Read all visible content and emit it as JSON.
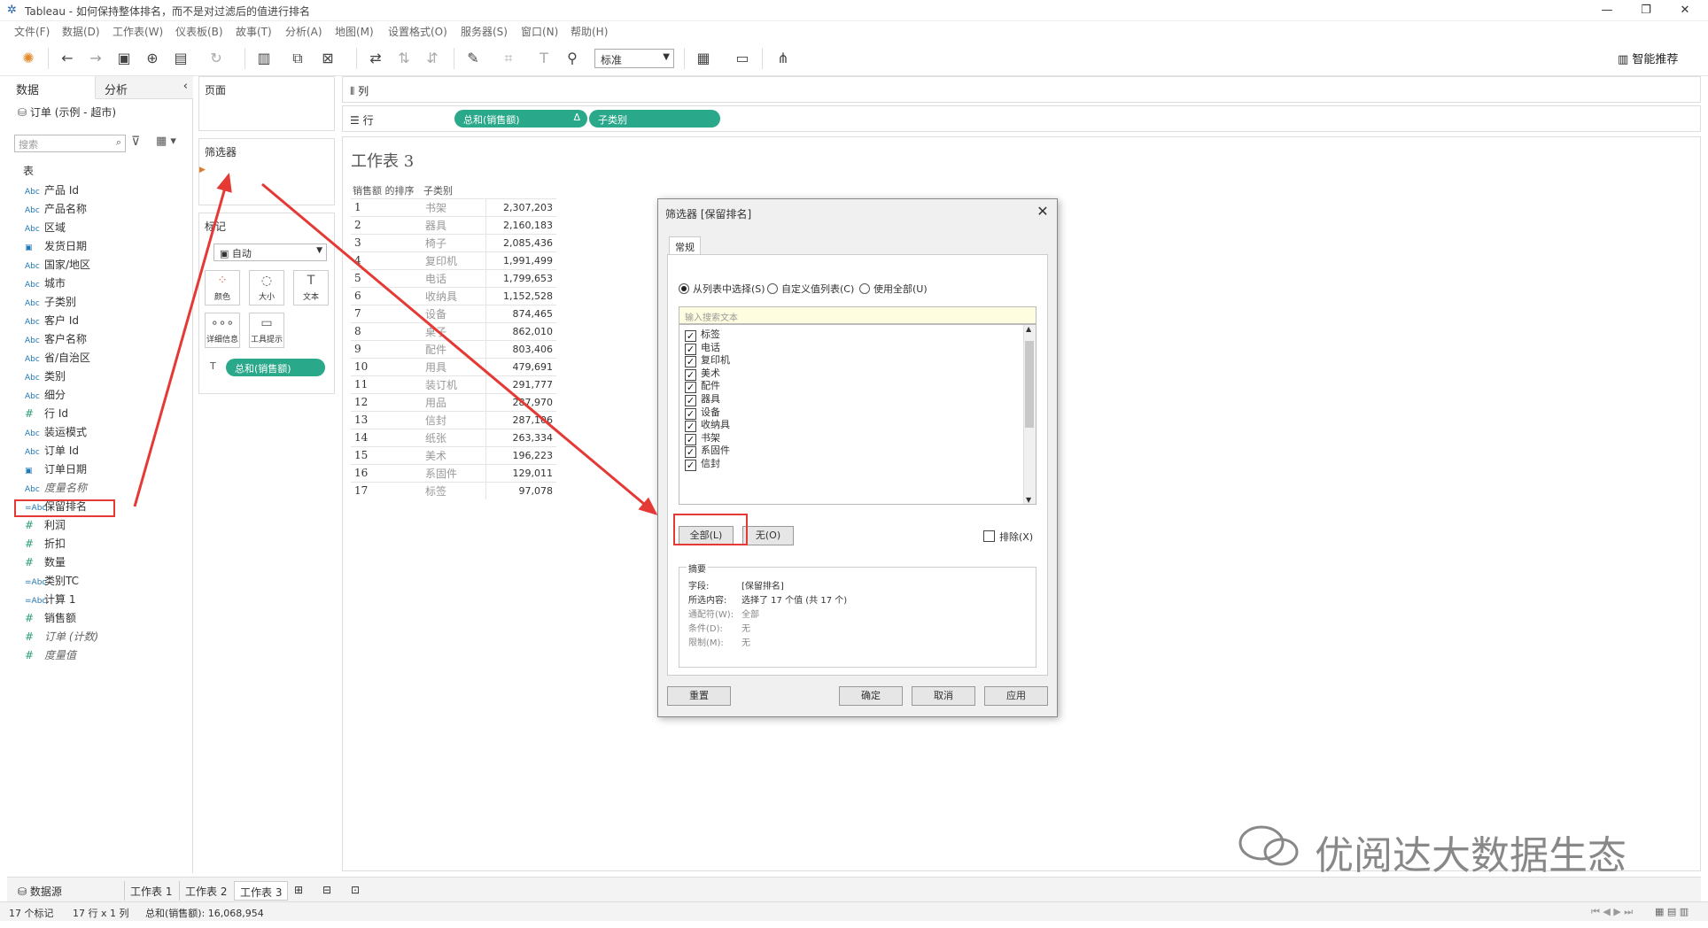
{
  "window": {
    "title": "Tableau - 如何保持整体排名，而不是对过滤后的值进行排名"
  },
  "menu": [
    "文件(F)",
    "数据(D)",
    "工作表(W)",
    "仪表板(B)",
    "故事(T)",
    "分析(A)",
    "地图(M)",
    "设置格式(O)",
    "服务器(S)",
    "窗口(N)",
    "帮助(H)"
  ],
  "toolbar": {
    "fit_select": "标准",
    "show_me": "智能推荐"
  },
  "left_pane": {
    "tabs": [
      "数据",
      "分析"
    ],
    "datasource": "订单 (示例 - 超市)",
    "search_placeholder": "搜索",
    "tables_heading": "表",
    "fields": [
      {
        "type": "Abc",
        "label": "产品 Id"
      },
      {
        "type": "Abc",
        "label": "产品名称"
      },
      {
        "type": "Abc",
        "label": "区域"
      },
      {
        "type": "date",
        "label": "发货日期"
      },
      {
        "type": "Abc",
        "label": "国家/地区"
      },
      {
        "type": "Abc",
        "label": "城市"
      },
      {
        "type": "Abc",
        "label": "子类别"
      },
      {
        "type": "Abc",
        "label": "客户 Id"
      },
      {
        "type": "Abc",
        "label": "客户名称"
      },
      {
        "type": "Abc",
        "label": "省/自治区"
      },
      {
        "type": "Abc",
        "label": "类别"
      },
      {
        "type": "Abc",
        "label": "细分"
      },
      {
        "type": "#",
        "label": "行 Id"
      },
      {
        "type": "Abc",
        "label": "装运模式"
      },
      {
        "type": "Abc",
        "label": "订单 Id"
      },
      {
        "type": "date",
        "label": "订单日期"
      },
      {
        "type": "Abc",
        "label": "度量名称",
        "italic": true
      },
      {
        "type": "=Abc",
        "label": "保留排名"
      },
      {
        "type": "#",
        "label": "利润"
      },
      {
        "type": "#",
        "label": "折扣"
      },
      {
        "type": "#",
        "label": "数量"
      },
      {
        "type": "=Abc",
        "label": "类别TC"
      },
      {
        "type": "=Abc",
        "label": "计算 1"
      },
      {
        "type": "#",
        "label": "销售额"
      },
      {
        "type": "#",
        "label": "订单 (计数)",
        "italic": true
      },
      {
        "type": "#",
        "label": "度量值",
        "italic": true
      }
    ]
  },
  "shelves": {
    "pages": "页面",
    "filters": "筛选器",
    "marks": "标记",
    "mark_type": "自动",
    "mark_buttons": [
      "颜色",
      "大小",
      "文本",
      "详细信息",
      "工具提示"
    ],
    "mark_pill": "总和(销售额)",
    "columns": "列",
    "rows": "行",
    "row_pills": [
      "总和(销售额)",
      "子类别"
    ]
  },
  "sheet": {
    "title": "工作表 3",
    "headers": [
      "销售额 的排序",
      "子类别"
    ],
    "rows": [
      {
        "rank": "1",
        "cat": "书架",
        "val": "2,307,203"
      },
      {
        "rank": "2",
        "cat": "器具",
        "val": "2,160,183"
      },
      {
        "rank": "3",
        "cat": "椅子",
        "val": "2,085,436"
      },
      {
        "rank": "4",
        "cat": "复印机",
        "val": "1,991,499"
      },
      {
        "rank": "5",
        "cat": "电话",
        "val": "1,799,653"
      },
      {
        "rank": "6",
        "cat": "收纳具",
        "val": "1,152,528"
      },
      {
        "rank": "7",
        "cat": "设备",
        "val": "874,465"
      },
      {
        "rank": "8",
        "cat": "桌子",
        "val": "862,010"
      },
      {
        "rank": "9",
        "cat": "配件",
        "val": "803,406"
      },
      {
        "rank": "10",
        "cat": "用具",
        "val": "479,691"
      },
      {
        "rank": "11",
        "cat": "装订机",
        "val": "291,777"
      },
      {
        "rank": "12",
        "cat": "用品",
        "val": "287,970"
      },
      {
        "rank": "13",
        "cat": "信封",
        "val": "287,106"
      },
      {
        "rank": "14",
        "cat": "纸张",
        "val": "263,334"
      },
      {
        "rank": "15",
        "cat": "美术",
        "val": "196,223"
      },
      {
        "rank": "16",
        "cat": "系固件",
        "val": "129,011"
      },
      {
        "rank": "17",
        "cat": "标签",
        "val": "97,078"
      }
    ]
  },
  "dialog": {
    "title": "筛选器 [保留排名]",
    "tab": "常规",
    "radios": [
      "从列表中选择(S)",
      "自定义值列表(C)",
      "使用全部(U)"
    ],
    "search_placeholder": "输入搜索文本",
    "items": [
      "标签",
      "电话",
      "复印机",
      "美术",
      "配件",
      "器具",
      "设备",
      "收纳具",
      "书架",
      "系固件",
      "信封"
    ],
    "all_button": "全部(L)",
    "none_button": "无(O)",
    "exclude": "排除(X)",
    "summary_title": "摘要",
    "summary": [
      {
        "k": "字段:",
        "v": "[保留排名]"
      },
      {
        "k": "所选内容:",
        "v": "选择了 17 个值 (共 17 个)"
      },
      {
        "k": "通配符(W):",
        "v": "全部",
        "dim": true
      },
      {
        "k": "条件(D):",
        "v": "无",
        "dim": true
      },
      {
        "k": "限制(M):",
        "v": "无",
        "dim": true
      }
    ],
    "reset": "重置",
    "ok": "确定",
    "cancel": "取消",
    "apply": "应用"
  },
  "bottom": {
    "datasource_tab": "数据源",
    "sheet_tabs": [
      "工作表 1",
      "工作表 2",
      "工作表 3"
    ]
  },
  "status": {
    "marks": "17 个标记",
    "dims": "17 行 x 1 列",
    "sum": "总和(销售额): 16,068,954"
  },
  "watermark": "优阅达大数据生态",
  "colors": {
    "pill": "#2aa88a",
    "highlight": "#e53935",
    "accent": "#1f77b4"
  }
}
